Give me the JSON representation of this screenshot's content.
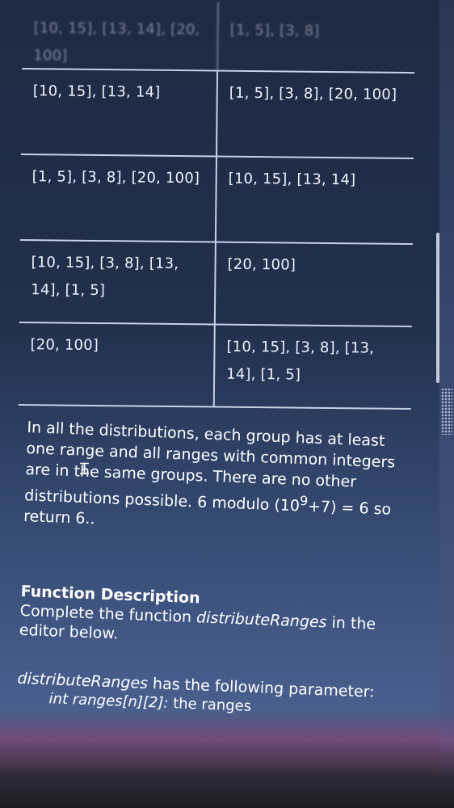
{
  "table": {
    "rows": [
      {
        "left": "[10, 15], [13, 14], [20, 100]",
        "right": "[1, 5], [3, 8]"
      },
      {
        "left": "[10, 15], [13, 14]",
        "right": "[1, 5], [3, 8], [20, 100]"
      },
      {
        "left": "[1, 5], [3, 8], [20, 100]",
        "right": "[10, 15], [13, 14]"
      },
      {
        "left": "[10, 15], [3, 8], [13, 14], [1, 5]",
        "right": "[20, 100]"
      },
      {
        "left": "[20, 100]",
        "right": "[10, 15], [3, 8], [13, 14], [1, 5]"
      }
    ]
  },
  "explanation": {
    "text": "In all the distributions, each group has at least one range and all ranges with common integers are in the same groups. There are no other distributions possible. 6 modulo (10",
    "sup": "9",
    "tail": "+7) = 6 so return 6.."
  },
  "function_description": {
    "heading": "Function Description",
    "line_prefix": "Complete the function ",
    "function_name": "distributeRanges",
    "line_suffix": " in the editor below."
  },
  "parameters": {
    "function_name": "distributeRanges",
    "intro_suffix": " has the following parameter:",
    "param_type": "int ranges[n][2]:",
    "param_desc": " the ranges"
  },
  "colors": {
    "background": "#22304c",
    "text": "#ffffff",
    "table_border": "#c8d1e6"
  }
}
